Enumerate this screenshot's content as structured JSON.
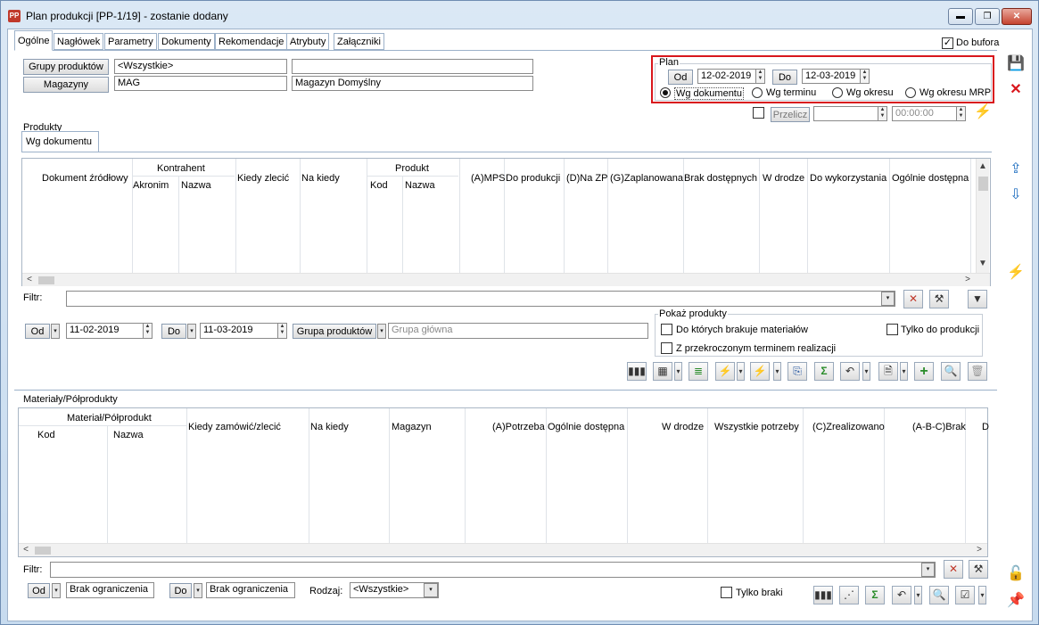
{
  "window": {
    "title": "Plan produkcji [PP-1/19] - zostanie dodany",
    "icon": "PP",
    "controls": {
      "minimize": "▬",
      "maximize": "❐",
      "close": "✕"
    }
  },
  "tabs": [
    "Ogólne",
    "Nagłówek",
    "Parametry",
    "Dokumenty",
    "Rekomendacje",
    "Atrybuty",
    "Załączniki"
  ],
  "do_bufora": {
    "label": "Do bufora",
    "checked": "✓"
  },
  "filters": {
    "grupy_produktow_label": "Grupy produktów",
    "grupy_produktow_value": "<Wszystkie>",
    "grupy_produktow_desc": "",
    "magazyny_label": "Magazyny",
    "magazyny_value": "MAG",
    "magazyny_desc": "Magazyn Domyślny"
  },
  "plan": {
    "legend": "Plan",
    "od_label": "Od",
    "od_value": "12-02-2019",
    "do_label": "Do",
    "do_value": "12-03-2019",
    "radio": [
      "Wg dokumentu",
      "Wg terminu",
      "Wg okresu",
      "Wg okresu MRP"
    ],
    "selected_index": 0
  },
  "przelicz": {
    "label": "Przelicz",
    "value": "",
    "time": "00:00:00"
  },
  "produkty": {
    "legend": "Produkty",
    "subtab": "Wg dokumentu",
    "headers": {
      "dokument": "Dokument źródłowy",
      "kontrahent": "Kontrahent",
      "akronim": "Akronim",
      "nazwa": "Nazwa",
      "kiedy_zlecic": "Kiedy zlecić",
      "na_kiedy": "Na kiedy",
      "produkt": "Produkt",
      "kod": "Kod",
      "nazwa2": "Nazwa",
      "mps": "(A)MPS",
      "do_produkcji": "Do produkcji",
      "na_zp": "(D)Na ZP",
      "zaplanowana": "(G)Zaplanowana",
      "brak_dostepnych": "Brak dostępnych",
      "w_drodze": "W drodze",
      "do_wykorzystania": "Do wykorzystania",
      "ogolnie_dostepna": "Ogólnie dostępna"
    },
    "filtr_label": "Filtr:",
    "od_label": "Od",
    "od_value": "11-02-2019",
    "do_label": "Do",
    "do_value": "11-03-2019",
    "grupa_label": "Grupa produktów",
    "grupa_value": "Grupa główna",
    "pokaz_legend": "Pokaż produkty",
    "pokaz_1": "Do których brakuje materiałów",
    "pokaz_2": "Z przekroczonym terminem realizacji",
    "pokaz_3": "Tylko do produkcji"
  },
  "materialy": {
    "legend": "Materiały/Półprodukty",
    "headers": {
      "material": "Materiał/Półprodukt",
      "kod": "Kod",
      "nazwa": "Nazwa",
      "kiedy": "Kiedy zamówić/zlecić",
      "na_kiedy": "Na kiedy",
      "magazyn": "Magazyn",
      "potrzeba": "(A)Potrzeba",
      "ogolnie": "Ogólnie dostępna",
      "w_drodze": "W drodze",
      "wszystkie": "Wszystkie potrzeby",
      "zrealizowano": "(C)Zrealizowano",
      "brak": "(A-B-C)Brak",
      "d": "D"
    },
    "filtr_label": "Filtr:",
    "od_label": "Od",
    "od_value": "Brak ograniczenia",
    "do_label": "Do",
    "do_value": "Brak ograniczenia",
    "rodzaj_label": "Rodzaj:",
    "rodzaj_value": "<Wszystkie>",
    "tylko_braki": "Tylko braki"
  },
  "icons": {
    "sigma": "Σ",
    "plus": "+",
    "magnifier": "🔍",
    "trash": "🗑",
    "lightning": "⚡",
    "save": "💾",
    "close_red": "✕",
    "lock": "🔓",
    "pin": "📌",
    "dropdown": "▾",
    "up": "▲",
    "down": "▼",
    "left": "<",
    "right": ">"
  }
}
